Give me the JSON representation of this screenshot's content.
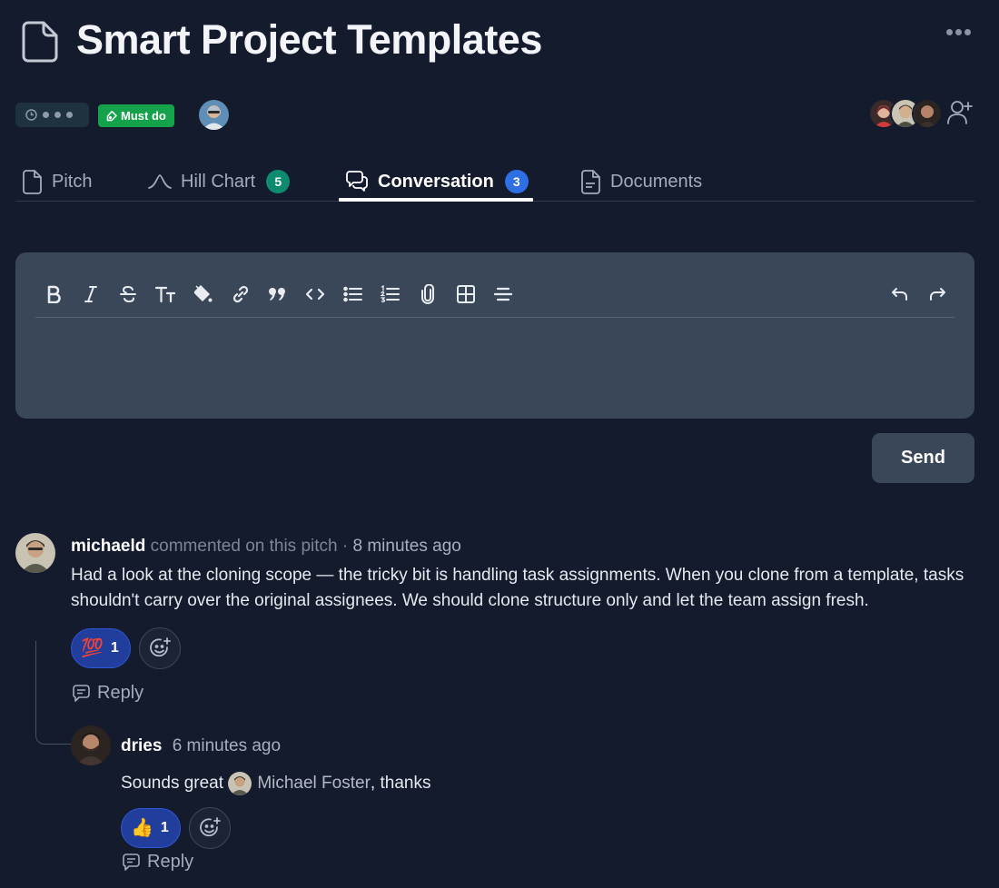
{
  "page": {
    "title": "Smart Project Templates"
  },
  "meta": {
    "priority_badge": "Must do",
    "colors": {
      "background": "#131b2d",
      "must_do_green": "#14a34a",
      "hill_chart_badge": "#0e8a6e",
      "conversation_badge": "#2f6fe4",
      "editor_bg": "#3a4759",
      "reaction_bg": "#213e9c"
    }
  },
  "tabs": [
    {
      "label": "Pitch",
      "icon": "file-icon"
    },
    {
      "label": "Hill Chart",
      "icon": "hill-chart-icon",
      "badge": "5"
    },
    {
      "label": "Conversation",
      "icon": "chat-bubbles-icon",
      "badge": "3",
      "active": true
    },
    {
      "label": "Documents",
      "icon": "document-icon"
    }
  ],
  "editor": {
    "toolbar": [
      "bold-icon",
      "italic-icon",
      "strikethrough-icon",
      "text-size-icon",
      "highlight-icon",
      "link-icon",
      "quote-icon",
      "code-icon",
      "bullet-list-icon",
      "numbered-list-icon",
      "attachment-icon",
      "table-icon",
      "horizontal-rule-icon",
      "undo-icon",
      "redo-icon"
    ],
    "send_label": "Send"
  },
  "comments": [
    {
      "author": "michaeld",
      "action": "commented on this pitch",
      "separator": "·",
      "time": "8 minutes ago",
      "body": "Had a look at the cloning scope — the tricky bit is handling task assignments. When you clone from a template, tasks shouldn't carry over the original assignees. We should clone structure only and let the team assign fresh.",
      "reaction": {
        "emoji": "💯",
        "count": "1"
      },
      "reply_label": "Reply",
      "replies": [
        {
          "author": "dries",
          "time": "6 minutes ago",
          "body_before": "Sounds great",
          "mention": "Michael Foster",
          "body_after": ", thanks",
          "reaction": {
            "emoji": "👍",
            "count": "1"
          },
          "reply_label": "Reply"
        }
      ]
    }
  ]
}
